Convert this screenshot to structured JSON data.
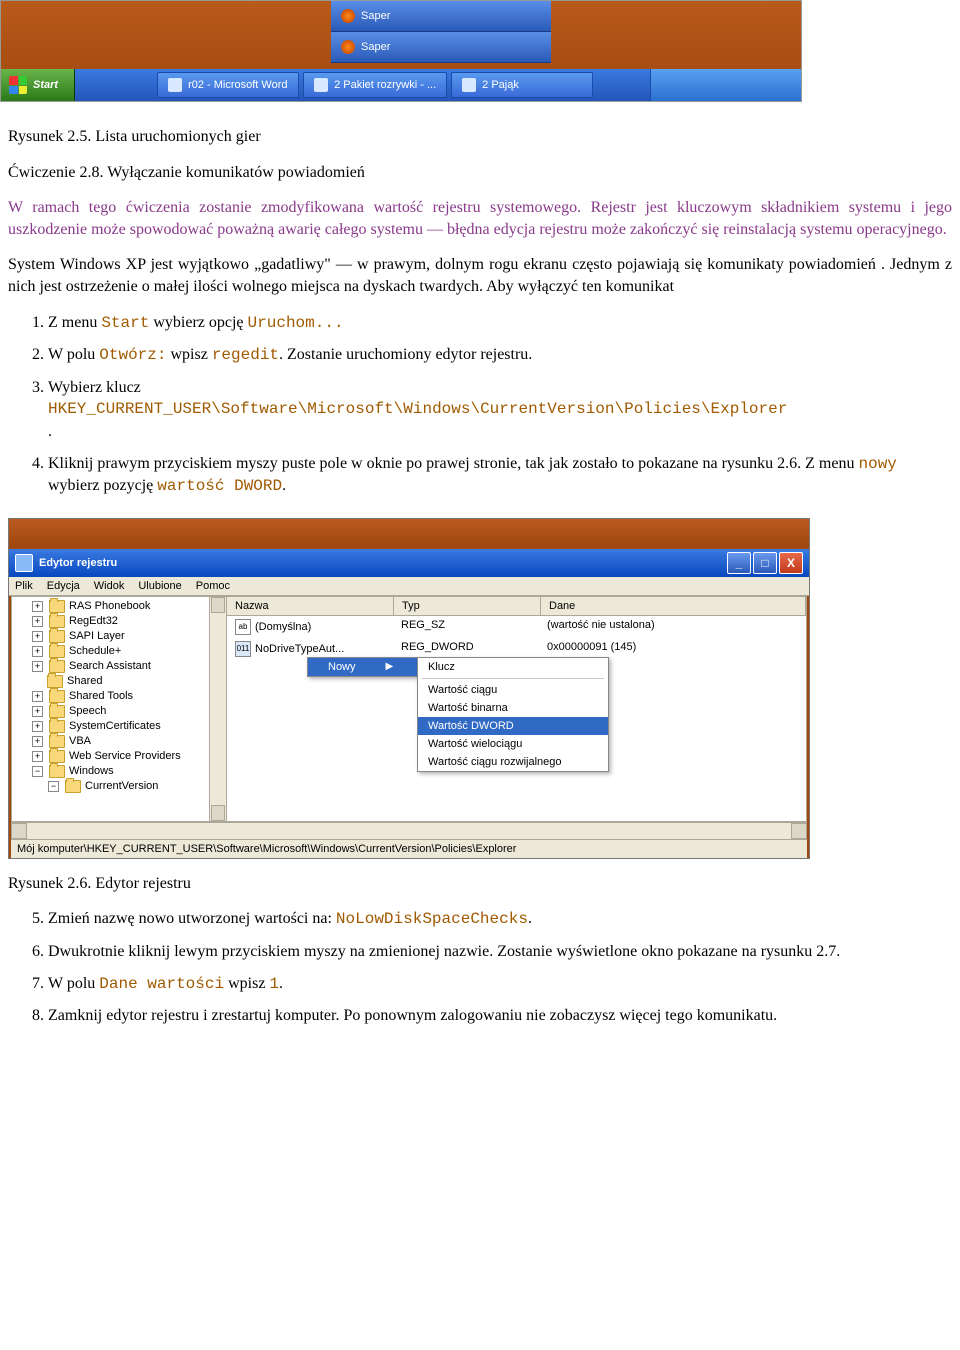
{
  "taskbar": {
    "tip1": "Saper",
    "tip2": "Saper",
    "start": "Start",
    "items": [
      "r02 - Microsoft Word",
      "2 Pakiet rozrywki - ...",
      "2 Pająk"
    ]
  },
  "caption1": "Rysunek 2.5. Lista uruchomionych gier",
  "exercise_title": "Ćwiczenie 2.8. Wyłączanie komunikatów powiadomień",
  "intro1": "W ramach tego ćwiczenia zostanie zmodyfikowana wartość rejestru systemowego. Rejestr jest kluczowym składnikiem systemu i jego uszkodzenie może spowodować poważną awarię całego systemu — błędna edycja rejestru może zakończyć się reinstalacją  systemu operacyjnego.",
  "para1": "System Windows XP jest wyjątkowo „gadatliwy\" — w prawym, dolnym rogu ekranu często pojawiają się komunikaty powiadomień . Jednym z nich jest ostrzeżenie o małej ilości wolnego miejsca na dyskach twardych. Aby wyłączyć ten komunikat",
  "li1a": "Z menu ",
  "li1b": "Start",
  "li1c": " wybierz opcję ",
  "li1d": "Uruchom...",
  "li2a": "W polu ",
  "li2b": "Otwórz:",
  "li2c": " wpisz ",
  "li2d": "regedit",
  "li2e": ". Zostanie uruchomiony edytor rejestru.",
  "li3a": "Wybierz klucz",
  "li3b": "HKEY_CURRENT_USER\\Software\\Microsoft\\Windows\\CurrentVersion\\Policies\\Explorer",
  "li3c": ".",
  "li4a": "Kliknij prawym przyciskiem myszy puste pole w oknie po prawej stronie, tak jak zostało to pokazane na rysunku 2.6. Z menu ",
  "li4b": "nowy",
  "li4c": " wybierz pozycję ",
  "li4d": "wartość DWORD",
  "li4e": ".",
  "regedit": {
    "title": "Edytor rejestru",
    "menu": [
      "Plik",
      "Edycja",
      "Widok",
      "Ulubione",
      "Pomoc"
    ],
    "tree": [
      "RAS Phonebook",
      "RegEdt32",
      "SAPI Layer",
      "Schedule+",
      "Search Assistant",
      "Shared",
      "Shared Tools",
      "Speech",
      "SystemCertificates",
      "VBA",
      "Web Service Providers",
      "Windows"
    ],
    "tree_child": "CurrentVersion",
    "headers": [
      "Nazwa",
      "Typ",
      "Dane"
    ],
    "rows": [
      {
        "name": "(Domyślna)",
        "type": "REG_SZ",
        "data": "(wartość nie ustalona)",
        "icon": "ab"
      },
      {
        "name": "NoDriveTypeAut...",
        "type": "REG_DWORD",
        "data": "0x00000091 (145)",
        "icon": "bin"
      }
    ],
    "ctx_new": "Nowy",
    "ctx_sub": [
      "Klucz",
      "Wartość ciągu",
      "Wartość binarna",
      "Wartość DWORD",
      "Wartość wielociągu",
      "Wartość ciągu rozwijalnego"
    ],
    "status": "Mój komputer\\HKEY_CURRENT_USER\\Software\\Microsoft\\Windows\\CurrentVersion\\Policies\\Explorer"
  },
  "caption2": "Rysunek 2.6. Edytor rejestru",
  "li5a": "Zmień nazwę nowo utworzonej wartości na: ",
  "li5b": "NoLowDiskSpaceChecks",
  "li5c": ".",
  "li6": "Dwukrotnie kliknij lewym przyciskiem myszy na zmienionej nazwie. Zostanie wyświetlone okno pokazane na rysunku 2.7.",
  "li7a": "W polu ",
  "li7b": "Dane wartości",
  "li7c": " wpisz ",
  "li7d": "1",
  "li7e": ".",
  "li8": "Zamknij edytor rejestru i zrestartuj komputer. Po ponownym zalogowaniu nie zobaczysz więcej tego komunikatu."
}
